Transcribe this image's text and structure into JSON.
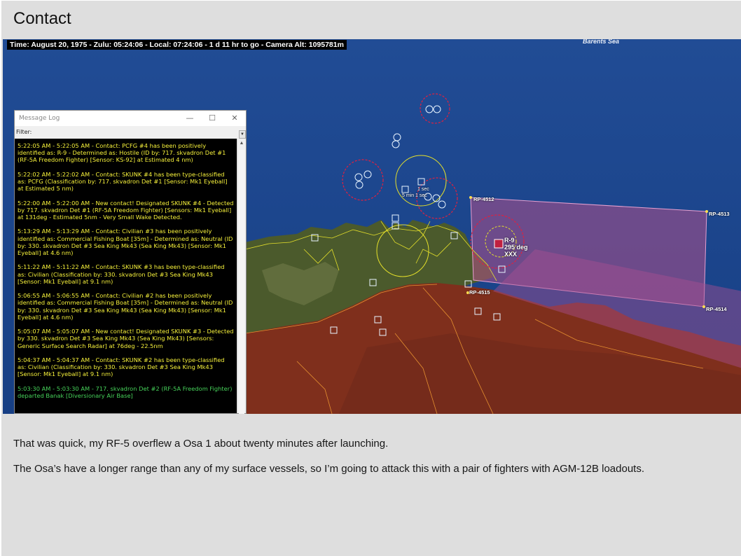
{
  "page": {
    "title": "Contact"
  },
  "screenshot": {
    "status_bar": "Time: August 20, 1975 - Zulu: 05:24:06 - Local: 07:24:06 - 1 d 11 hr to go -  Camera Alt: 1095781m",
    "sea_label": "Barents Sea",
    "reference_points": [
      "RP-4512",
      "RP-4513",
      "RP-4514",
      "RP-4515"
    ],
    "contact_label": [
      "R-9",
      "295 deg",
      "XXX"
    ],
    "misc_labels": [
      "1 sec",
      "5 min 1 sec"
    ],
    "colors": {
      "ocean": "#1c4a93",
      "land": "#8b2e1a",
      "zone": "#b0508a",
      "hostile": "#e02040",
      "friendly_circle": "#e5e02a"
    }
  },
  "message_log": {
    "title": "Message Log",
    "filter_label": "Filter:",
    "window_buttons": [
      "—",
      "☐",
      "✕"
    ],
    "entries": [
      {
        "text": "5:22:05 AM - 5:22:05 AM - Contact: PCFG #4 has been positively identified as: R-9 - Determined as: Hostile (ID by: 717. skvadron Det #1 (RF-5A Freedom Fighter) [Sensor: KS-92] at Estimated 4 nm)",
        "color": "yellow"
      },
      {
        "text": "5:22:02 AM - 5:22:02 AM - Contact: SKUNK #4 has been type-classified as: PCFG (Classification by: 717. skvadron Det #1 [Sensor: Mk1 Eyeball] at Estimated 5 nm)",
        "color": "yellow"
      },
      {
        "text": "5:22:00 AM - 5:22:00 AM - New contact! Designated SKUNK #4 - Detected by 717. skvadron Det #1 (RF-5A Freedom Fighter) [Sensors: Mk1 Eyeball] at 131deg - Estimated 5nm - Very Small Wake Detected.",
        "color": "yellow"
      },
      {
        "text": "5:13:29 AM - 5:13:29 AM - Contact: Civilian #3 has been positively identified as: Commercial Fishing Boat [35m] - Determined as: Neutral (ID by: 330. skvadron Det #3 Sea King Mk43 (Sea King Mk43) [Sensor: Mk1 Eyeball] at 4.6 nm)",
        "color": "yellow"
      },
      {
        "text": "5:11:22 AM - 5:11:22 AM - Contact: SKUNK #3 has been type-classified as: Civilian (Classification by: 330. skvadron Det #3 Sea King Mk43 [Sensor: Mk1 Eyeball] at 9.1 nm)",
        "color": "yellow"
      },
      {
        "text": "5:06:55 AM - 5:06:55 AM - Contact: Civilian #2 has been positively identified as: Commercial Fishing Boat [35m] - Determined as: Neutral (ID by: 330. skvadron Det #3 Sea King Mk43 (Sea King Mk43) [Sensor: Mk1 Eyeball] at 4.6 nm)",
        "color": "yellow"
      },
      {
        "text": "5:05:07 AM - 5:05:07 AM - New contact! Designated SKUNK #3 - Detected by 330. skvadron Det #3 Sea King Mk43 (Sea King Mk43) [Sensors: Generic Surface Search Radar] at 76deg - 22.5nm",
        "color": "yellow"
      },
      {
        "text": "5:04:37 AM - 5:04:37 AM - Contact: SKUNK #2 has been type-classified as: Civilian (Classification by: 330. skvadron Det #3 Sea King Mk43 [Sensor: Mk1 Eyeball] at 9.1 nm)",
        "color": "yellow"
      },
      {
        "text": "5:03:30 AM - 5:03:30 AM - 717. skvadron Det #2 (RF-5A Freedom Fighter) departed Banak [Diversionary Air Base]",
        "color": "green"
      }
    ]
  },
  "paragraphs": [
    "That was quick, my RF-5 overflew a Osa 1 about twenty minutes after launching.",
    "The Osa’s have a longer range than any of my surface vessels, so I’m going to attack this with a pair of fighters with AGM-12B loadouts."
  ]
}
